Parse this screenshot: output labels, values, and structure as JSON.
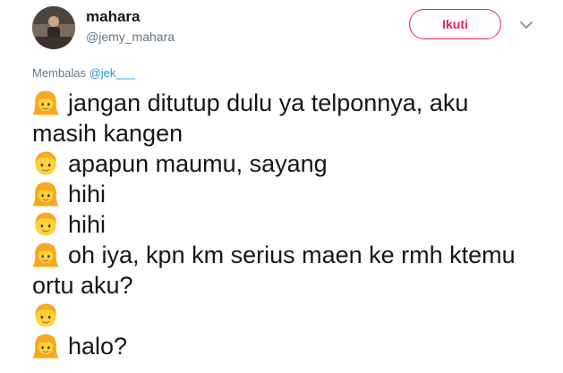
{
  "user": {
    "name": "mahara",
    "handle": "@jemy_mahara"
  },
  "follow_button": {
    "label": "Ikuti"
  },
  "reply": {
    "prefix": "Membalas",
    "mention": "@jek___"
  },
  "colors": {
    "accent": "#e0245e",
    "link": "#1b95e0",
    "muted": "#657786",
    "text": "#14171a"
  },
  "tweet": {
    "lines": [
      {
        "emoji": "girl-emoji",
        "text": "jangan ditutup dulu ya telponnya, aku"
      },
      {
        "emoji": null,
        "text": "masih kangen"
      },
      {
        "emoji": "boy-emoji",
        "text": "apapun maumu, sayang"
      },
      {
        "emoji": "girl-emoji",
        "text": "hihi"
      },
      {
        "emoji": "boy-emoji",
        "text": "hihi"
      },
      {
        "emoji": "girl-emoji",
        "text": "oh iya, kpn km serius maen ke rmh ktemu"
      },
      {
        "emoji": null,
        "text": "ortu aku?"
      },
      {
        "emoji": "boy-emoji",
        "text": ""
      },
      {
        "emoji": "girl-emoji",
        "text": "halo?"
      }
    ]
  }
}
